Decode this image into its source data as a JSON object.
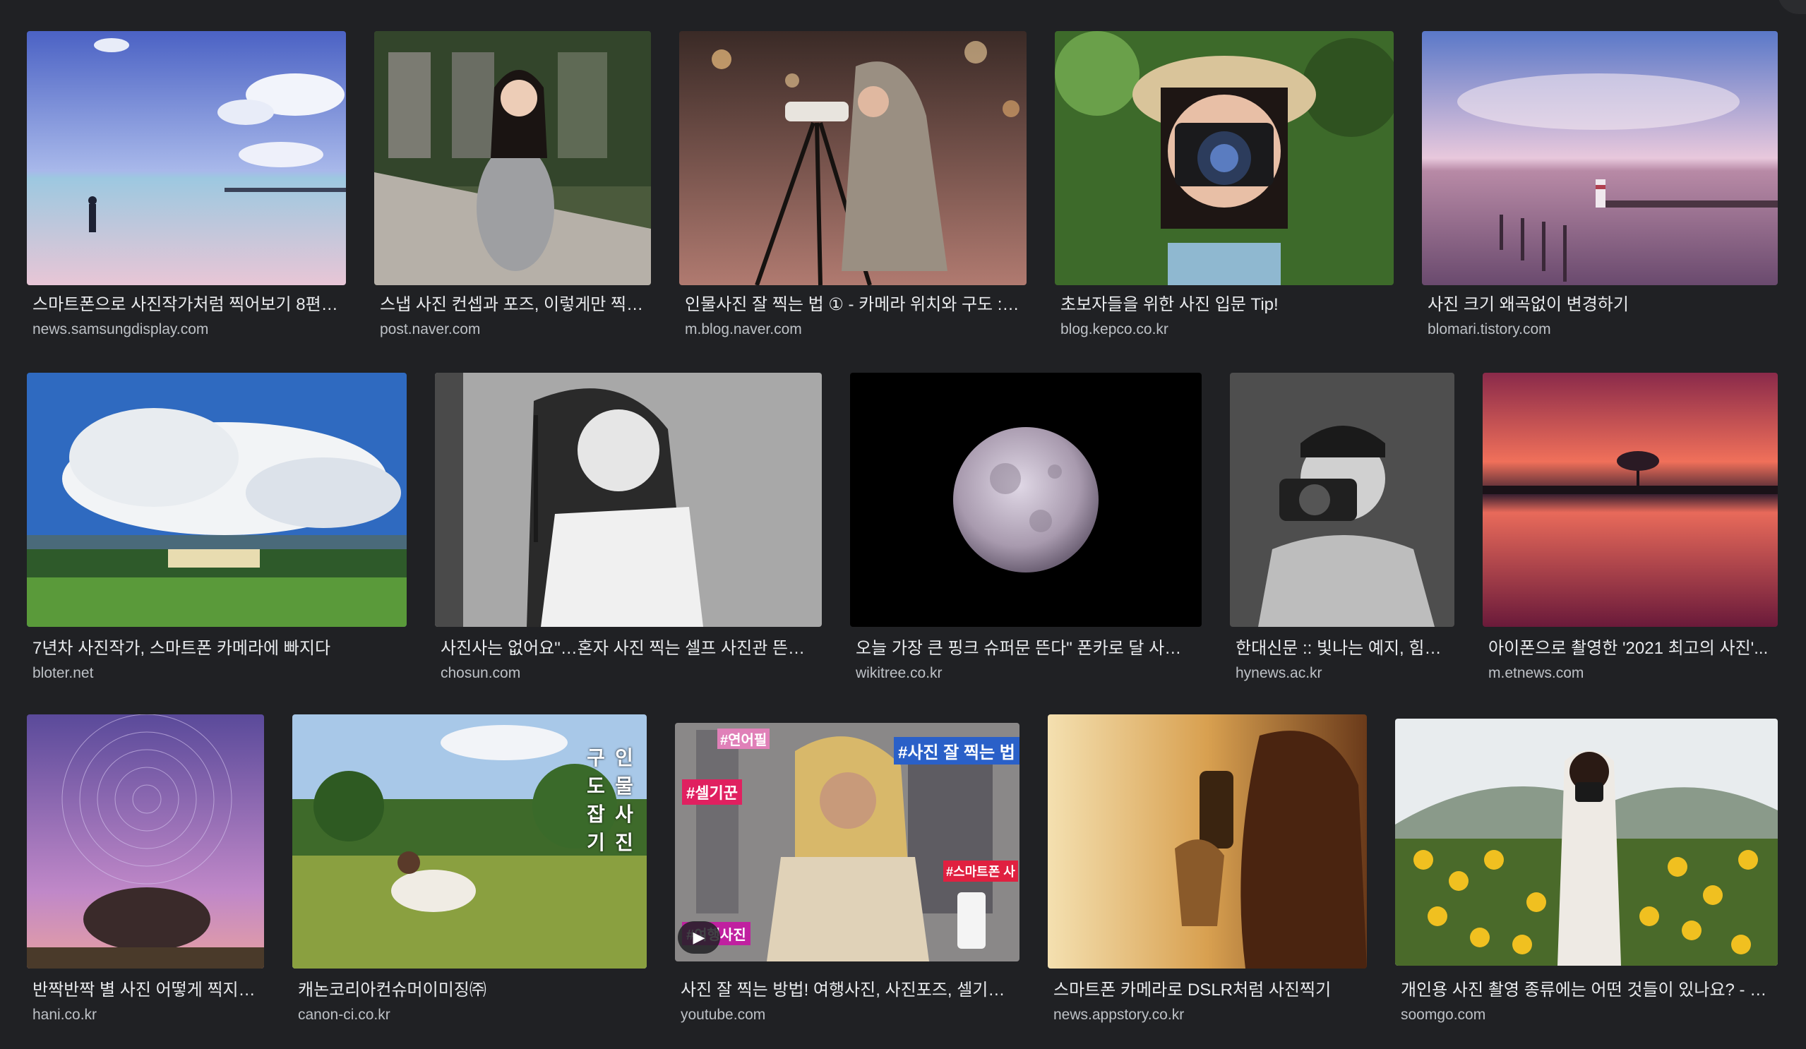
{
  "results": [
    {
      "title": "스마트폰으로 사진작가처럼 찍어보기 8편 –...",
      "source": "news.samsungdisplay.com"
    },
    {
      "title": "스냅 사진 컨셉과 포즈, 이렇게만 찍으...",
      "source": "post.naver.com"
    },
    {
      "title": "인물사진 잘 찍는 법 ① - 카메라 위치와 구도 : 네...",
      "source": "m.blog.naver.com"
    },
    {
      "title": "초보자들을 위한 사진 입문 Tip!",
      "source": "blog.kepco.co.kr"
    },
    {
      "title": "사진 크기 왜곡없이 변경하기",
      "source": "blomari.tistory.com"
    },
    {
      "title": "7년차 사진작가, 스마트폰 카메라에 빠지다",
      "source": "bloter.net"
    },
    {
      "title": "사진사는 없어요\"…혼자 사진 찍는 셀프 사진관 뜬다 - ...",
      "source": "chosun.com"
    },
    {
      "title": "오늘 가장 큰 핑크 슈퍼문 뜬다\" 폰카로 달 사진 ...",
      "source": "wikitree.co.kr"
    },
    {
      "title": "한대신문 :: 빛나는 예지, 힘찬 ...",
      "source": "hynews.ac.kr"
    },
    {
      "title": "아이폰으로 촬영한 '2021 최고의 사진'...",
      "source": "m.etnews.com"
    },
    {
      "title": "반짝반짝 별 사진 어떻게 찍지? :...",
      "source": "hani.co.kr"
    },
    {
      "title": "캐논코리아컨슈머이미징㈜",
      "source": "canon-ci.co.kr"
    },
    {
      "title": "사진 잘 찍는 방법! 여행사진, 사진포즈, 셀기꾼, ...",
      "source": "youtube.com",
      "play_icon": "play-icon"
    },
    {
      "title": "스마트폰 카메라로 DSLR처럼 사진찍기",
      "source": "news.appstory.co.kr"
    },
    {
      "title": "개인용 사진 촬영 종류에는 어떤 것들이 있나요? - 숨...",
      "source": "soomgo.com"
    }
  ],
  "thumb_overlays": {
    "vertical_text": [
      "인",
      "물",
      "사",
      "진",
      "구",
      "도",
      "잡",
      "기"
    ],
    "tag_1": "#셀기꾼",
    "tag_2": "#사진 잘 찍는 법",
    "tag_3": "#스마트폰 사",
    "tag_4": "#연어필",
    "tag_5": "#여행사진"
  },
  "colors": {
    "background": "#202124",
    "title": "#e8eaed",
    "source": "#bdc1c6"
  }
}
